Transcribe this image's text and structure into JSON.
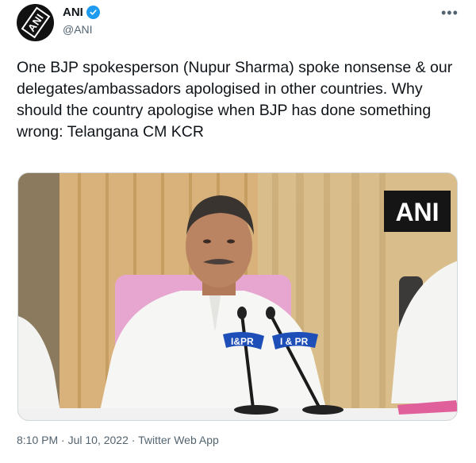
{
  "account": {
    "display_name": "ANI",
    "handle": "@ANI",
    "avatar_text": "ANI",
    "verified_icon": "verified-badge-icon"
  },
  "menu": {
    "more_glyph": "•••"
  },
  "tweet": {
    "text": "One BJP spokesperson (Nupur Sharma) spoke nonsense & our delegates/ambassadors apologised in other countries. Why should the country apologise when BJP has done something wrong: Telangana CM KCR"
  },
  "media": {
    "watermark": "ANI",
    "mic_label_left": "I&PR",
    "mic_label_right": "I & PR"
  },
  "meta": {
    "time": "8:10 PM",
    "separator": "·",
    "date": "Jul 10, 2022",
    "source": "Twitter Web App"
  },
  "colors": {
    "accent": "#1d9bf0",
    "text": "#0f1419",
    "secondary": "#536471"
  }
}
